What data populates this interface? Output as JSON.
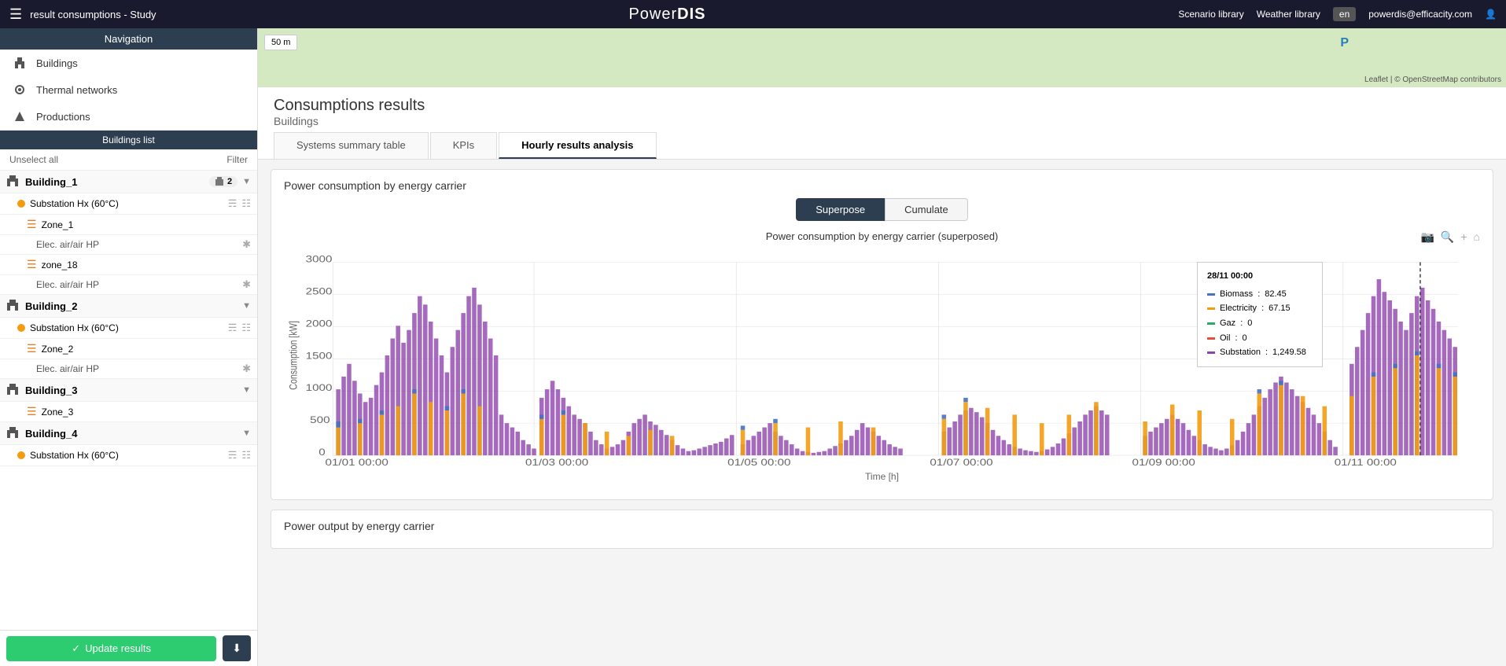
{
  "app": {
    "title": "PowerDIS",
    "subtitle": "result consumptions - Study",
    "lang": "en",
    "user": "powerdis@efficacity.com"
  },
  "topbar": {
    "scenario_library": "Scenario library",
    "weather_library": "Weather library",
    "lang": "en",
    "user_email": "powerdis@efficacity.com"
  },
  "sidebar": {
    "navigation_label": "Navigation",
    "buildings_label": "Buildings",
    "thermal_networks_label": "Thermal networks",
    "productions_label": "Productions",
    "buildings_list_label": "Buildings list",
    "unselect_all": "Unselect all",
    "filter": "Filter",
    "buildings": [
      {
        "id": "Building_1",
        "badge": "2",
        "substations": [
          {
            "name": "Substation Hx (60°C)",
            "zones": [
              {
                "name": "Zone_1",
                "systems": [
                  "Elec. air/air HP"
                ]
              },
              {
                "name": "zone_18",
                "systems": [
                  "Elec. air/air HP"
                ]
              }
            ]
          }
        ]
      },
      {
        "id": "Building_2",
        "substations": [
          {
            "name": "Substation Hx (60°C)",
            "zones": [
              {
                "name": "Zone_2",
                "systems": [
                  "Elec. air/air HP"
                ]
              }
            ]
          }
        ]
      },
      {
        "id": "Building_3",
        "zones": [
          {
            "name": "Zone_3",
            "systems": []
          }
        ]
      },
      {
        "id": "Building_4",
        "substations": [
          {
            "name": "Substation Hx (60°C)",
            "zones": []
          }
        ]
      }
    ],
    "update_results": "Update results"
  },
  "map": {
    "scale_label": "50 m",
    "leaflet_credit": "Leaflet | © OpenStreetMap contributors"
  },
  "results": {
    "title": "Consumptions results",
    "subtitle": "Buildings",
    "tabs": [
      {
        "id": "systems_summary",
        "label": "Systems summary table"
      },
      {
        "id": "kpis",
        "label": "KPIs"
      },
      {
        "id": "hourly_analysis",
        "label": "Hourly results analysis",
        "active": true
      }
    ]
  },
  "chart1": {
    "section_title": "Power consumption by energy carrier",
    "toggle_superpose": "Superpose",
    "toggle_cumulate": "Cumulate",
    "title": "Power consumption by energy carrier (superposed)",
    "y_label": "Consumption [kW]",
    "x_label": "Time [h]",
    "y_ticks": [
      "0",
      "500",
      "1000",
      "1500",
      "2000",
      "2500",
      "3000"
    ],
    "x_ticks": [
      "01/01 00:00",
      "01/03 00:00",
      "01/05 00:00",
      "01/07 00:00",
      "01/09 00:00",
      "01/11 00:00"
    ],
    "tooltip": {
      "date": "28/11 00:00",
      "biomass_label": "Biomass",
      "biomass_value": "82.45",
      "electricity_label": "Electricity",
      "electricity_value": "67.15",
      "gaz_label": "Gaz",
      "gaz_value": "0",
      "oil_label": "Oil",
      "oil_value": "0",
      "substation_label": "Substation",
      "substation_value": "1,249.58"
    },
    "legend": {
      "biomass_color": "#4472c4",
      "electricity_color": "#f39c12",
      "gaz_color": "#27ae60",
      "oil_color": "#e74c3c",
      "substation_color": "#8e44ad"
    }
  },
  "chart2": {
    "section_title": "Power output by energy carrier"
  }
}
